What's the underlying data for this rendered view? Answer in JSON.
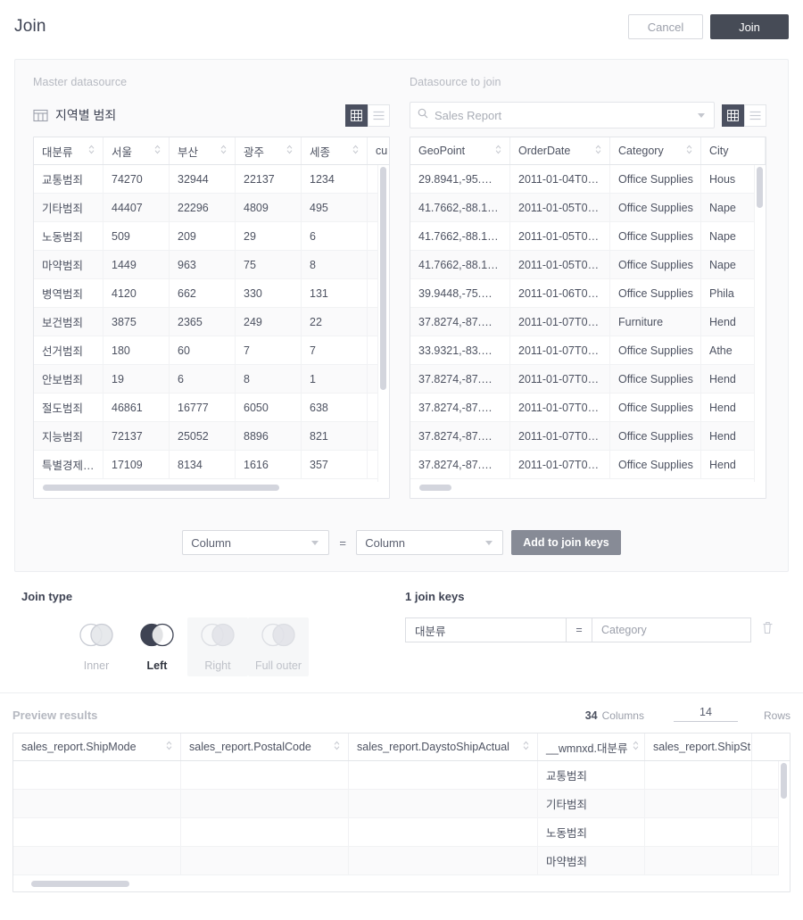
{
  "header": {
    "title": "Join",
    "cancel_label": "Cancel",
    "join_label": "Join"
  },
  "master": {
    "caption": "Master datasource",
    "title": "지역별 범죄",
    "view_grid_icon": "grid-view-icon",
    "view_list_icon": "list-view-icon",
    "columns": [
      "대분류",
      "서울",
      "부산",
      "광주",
      "세종",
      "cu"
    ],
    "rows": [
      [
        "교통범죄",
        "74270",
        "32944",
        "22137",
        "1234",
        ""
      ],
      [
        "기타범죄",
        "44407",
        "22296",
        "4809",
        "495",
        ""
      ],
      [
        "노동범죄",
        "509",
        "209",
        "29",
        "6",
        ""
      ],
      [
        "마약범죄",
        "1449",
        "963",
        "75",
        "8",
        ""
      ],
      [
        "병역범죄",
        "4120",
        "662",
        "330",
        "131",
        ""
      ],
      [
        "보건범죄",
        "3875",
        "2365",
        "249",
        "22",
        ""
      ],
      [
        "선거범죄",
        "180",
        "60",
        "7",
        "7",
        ""
      ],
      [
        "안보범죄",
        "19",
        "6",
        "8",
        "1",
        ""
      ],
      [
        "절도범죄",
        "46861",
        "16777",
        "6050",
        "638",
        ""
      ],
      [
        "지능범죄",
        "72137",
        "25052",
        "8896",
        "821",
        ""
      ],
      [
        "특별경제…",
        "17109",
        "8134",
        "1616",
        "357",
        ""
      ]
    ]
  },
  "joinsource": {
    "caption": "Datasource to join",
    "search_value": "Sales Report",
    "search_icon": "search-icon",
    "columns": [
      "GeoPoint",
      "OrderDate",
      "Category",
      "City"
    ],
    "rows": [
      [
        "29.8941,-95.…",
        "2011-01-04T0…",
        "Office Supplies",
        "Hous"
      ],
      [
        "41.7662,-88.1…",
        "2011-01-05T0…",
        "Office Supplies",
        "Nape"
      ],
      [
        "41.7662,-88.1…",
        "2011-01-05T0…",
        "Office Supplies",
        "Nape"
      ],
      [
        "41.7662,-88.1…",
        "2011-01-05T0…",
        "Office Supplies",
        "Nape"
      ],
      [
        "39.9448,-75.…",
        "2011-01-06T0…",
        "Office Supplies",
        "Phila"
      ],
      [
        "37.8274,-87.…",
        "2011-01-07T0…",
        "Furniture",
        "Hend"
      ],
      [
        "33.9321,-83.…",
        "2011-01-07T0…",
        "Office Supplies",
        "Athe"
      ],
      [
        "37.8274,-87.…",
        "2011-01-07T0…",
        "Office Supplies",
        "Hend"
      ],
      [
        "37.8274,-87.…",
        "2011-01-07T0…",
        "Office Supplies",
        "Hend"
      ],
      [
        "37.8274,-87.…",
        "2011-01-07T0…",
        "Office Supplies",
        "Hend"
      ],
      [
        "37.8274,-87.…",
        "2011-01-07T0…",
        "Office Supplies",
        "Hend"
      ]
    ]
  },
  "keybuilder": {
    "left_value": "Column",
    "equals": "=",
    "right_value": "Column",
    "add_label": "Add to join keys"
  },
  "jointype": {
    "label": "Join type",
    "options": [
      {
        "id": "inner",
        "label": "Inner",
        "state": "enabled"
      },
      {
        "id": "left",
        "label": "Left",
        "state": "selected"
      },
      {
        "id": "right",
        "label": "Right",
        "state": "disabled"
      },
      {
        "id": "full-outer",
        "label": "Full outer",
        "state": "disabled"
      }
    ]
  },
  "joinkeys": {
    "label": "1 join keys",
    "items": [
      {
        "left": "대분류",
        "equals": "=",
        "right": "Category",
        "delete_icon": "trash-icon"
      }
    ]
  },
  "preview": {
    "title": "Preview results",
    "columns_count": "34",
    "columns_label": "Columns",
    "rows_value": "14",
    "rows_label": "Rows",
    "columns": [
      "sales_report.ShipMode",
      "sales_report.PostalCode",
      "sales_report.DaystoShipActual",
      "__wmnxd.대분류",
      "sales_report.ShipSt"
    ],
    "rows": [
      [
        "",
        "",
        "",
        "교통범죄",
        ""
      ],
      [
        "",
        "",
        "",
        "기타범죄",
        ""
      ],
      [
        "",
        "",
        "",
        "노동범죄",
        ""
      ],
      [
        "",
        "",
        "",
        "마약범죄",
        ""
      ]
    ]
  },
  "colors": {
    "accent_dark": "#464b56",
    "panel_bg": "#fafafb",
    "border": "#e3e5e9",
    "muted_text": "#b6b9c1"
  }
}
